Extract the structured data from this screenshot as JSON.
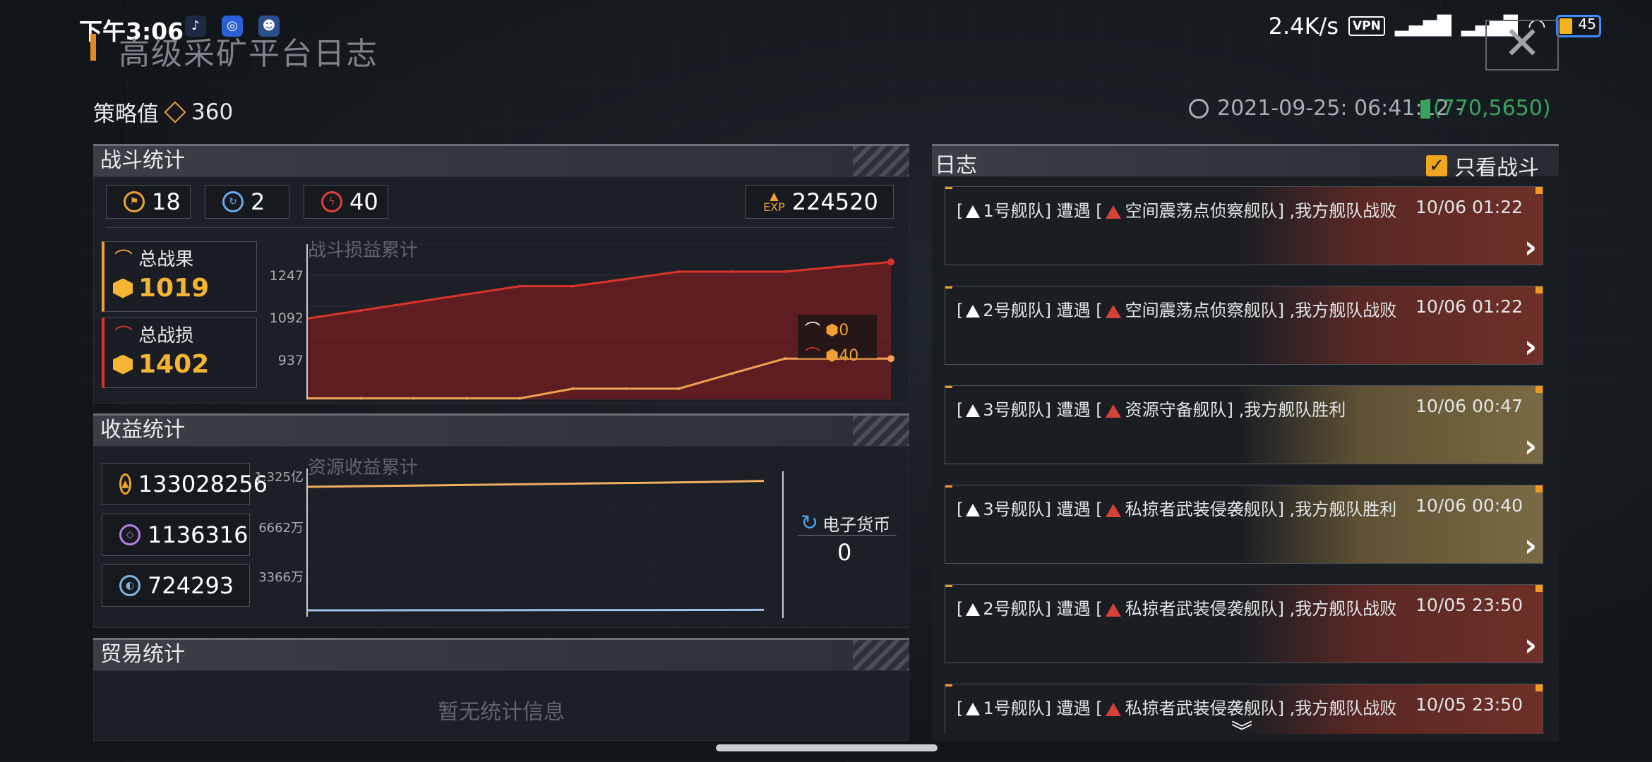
{
  "status_bar": {
    "time": "下午3:06",
    "net_speed": "2.4K/s",
    "vpn": "VPN",
    "battery": "45"
  },
  "header": {
    "title": "高级采矿平台日志",
    "close_label": "✕"
  },
  "strategy": {
    "label": "策略值",
    "value": "360"
  },
  "timestamp": "2021-09-25: 06:41:12 -",
  "coords": "(770,5650)",
  "battle": {
    "title": "战斗统计",
    "stats": [
      "18",
      "2",
      "40"
    ],
    "exp_label": "EXP",
    "exp": "224520",
    "total_win_label": "总战果",
    "total_win": "1019",
    "total_loss_label": "总战损",
    "total_loss": "1402",
    "chart_title": "战斗损益累计",
    "y_ticks": [
      "1247",
      "1092",
      "937"
    ],
    "legend": [
      "0",
      "40"
    ]
  },
  "income": {
    "title": "收益统计",
    "values": [
      "133028256",
      "1136316",
      "724293"
    ],
    "chart_title": "资源收益累计",
    "y_ticks": [
      "1.325亿",
      "6662万",
      "3366万"
    ],
    "currency_label": "电子货币",
    "currency_value": "0"
  },
  "trade": {
    "title": "贸易统计",
    "empty": "暂无统计信息"
  },
  "log": {
    "title": "日志",
    "filter_label": "只看战斗",
    "items": [
      {
        "fleet": "1号舰队",
        "enemy": "空间震荡点侦察舰队",
        "result": ",我方舰队战败",
        "time": "10/06 01:22",
        "win": false
      },
      {
        "fleet": "2号舰队",
        "enemy": "空间震荡点侦察舰队",
        "result": ",我方舰队战败",
        "time": "10/06 01:22",
        "win": false
      },
      {
        "fleet": "3号舰队",
        "enemy": "资源守备舰队",
        "result": ",我方舰队胜利",
        "time": "10/06 00:47",
        "win": true
      },
      {
        "fleet": "3号舰队",
        "enemy": "私掠者武装侵袭舰队",
        "result": ",我方舰队胜利",
        "time": "10/06 00:40",
        "win": true
      },
      {
        "fleet": "2号舰队",
        "enemy": "私掠者武装侵袭舰队",
        "result": ",我方舰队战败",
        "time": "10/05 23:50",
        "win": false
      },
      {
        "fleet": "1号舰队",
        "enemy": "私掠者武装侵袭舰队",
        "result": ",我方舰队战败",
        "time": "10/05 23:50",
        "win": false
      }
    ],
    "encounter": "遭遇"
  },
  "chart_data": [
    {
      "type": "area",
      "title": "战斗损益累计",
      "ylim": [
        850,
        1330
      ],
      "y_ticks": [
        1247,
        1092,
        937
      ],
      "x": [
        0,
        1,
        2,
        3,
        4,
        5,
        6,
        7,
        8,
        9,
        10,
        11
      ],
      "series": [
        {
          "color": "#d9342b",
          "values": [
            1100,
            1125,
            1150,
            1175,
            1200,
            1200,
            1222,
            1245,
            1245,
            1245,
            1260,
            1275
          ]
        },
        {
          "color": "#f0a050",
          "values": [
            853,
            853,
            853,
            853,
            853,
            883,
            883,
            883,
            930,
            976,
            976,
            976
          ]
        }
      ],
      "legend": [
        "0",
        "40"
      ]
    },
    {
      "type": "line",
      "title": "资源收益累计",
      "ylim": [
        0,
        140000000
      ],
      "y_ticks": [
        "1.325亿",
        "6662万",
        "3366万"
      ],
      "x": [
        0,
        1,
        2,
        3,
        4,
        5,
        6,
        7,
        8
      ],
      "series": [
        {
          "color": "#f0b060",
          "values": [
            127000000,
            127700000,
            128400000,
            129100000,
            129800000,
            130500000,
            131200000,
            132000000,
            133028256
          ]
        },
        {
          "color": "#9fc3e8",
          "values": [
            700000,
            750000,
            800000,
            850000,
            900000,
            950000,
            1000000,
            1070000,
            1136316
          ]
        }
      ]
    }
  ],
  "colors": {
    "accent": "#f5b431",
    "loss": "#d9342b",
    "win_bg": "#6b5a35",
    "loss_bg": "#5a2622"
  }
}
